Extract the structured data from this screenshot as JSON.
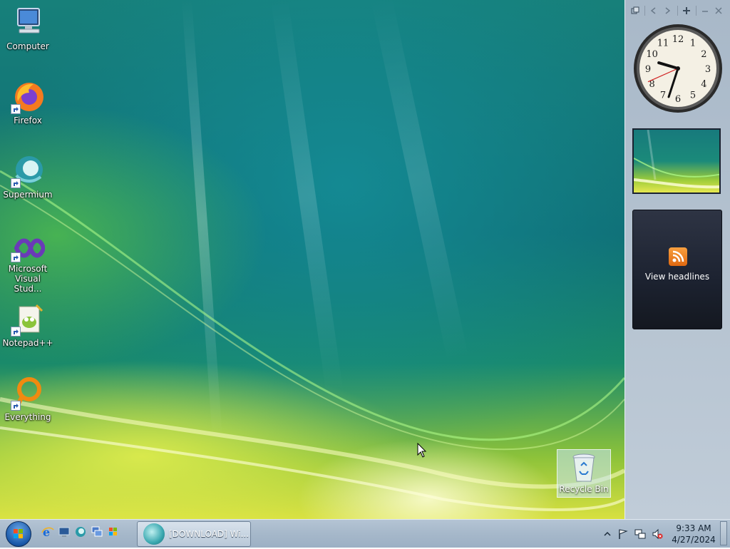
{
  "desktop": {
    "icons": [
      {
        "label": "Computer"
      },
      {
        "label": "Firefox"
      },
      {
        "label": "Supermium"
      },
      {
        "label": "Microsoft Visual Stud..."
      },
      {
        "label": "Notepad++"
      },
      {
        "label": "Everything"
      }
    ],
    "recycle_bin": {
      "label": "Recycle Bin"
    }
  },
  "gadgets": {
    "clock": {
      "hour": 9,
      "minute": 33,
      "second": 41,
      "numerals": [
        "12",
        "1",
        "2",
        "3",
        "4",
        "5",
        "6",
        "7",
        "8",
        "9",
        "10",
        "11"
      ]
    },
    "feeds": {
      "label": "View headlines"
    }
  },
  "taskbar": {
    "task_button": {
      "label": "[DOWNLOAD] Wi..."
    },
    "time": "9:33 AM",
    "date": "4/27/2024",
    "icons": {
      "start": "windows-orb-icon",
      "quick_launch": [
        "internet-explorer-icon",
        "show-desktop-icon",
        "supermium-icon",
        "switch-windows-icon",
        "windows-icon"
      ],
      "tray": [
        "show-hidden-icons-icon",
        "action-center-flag-icon",
        "network-icon",
        "volume-muted-icon"
      ]
    }
  },
  "colors": {
    "sidebar": "#b4c2d0",
    "taskbar": "#a6b8ca",
    "feed_bg": "#1c2230",
    "rss_orange": "#f08a24"
  }
}
